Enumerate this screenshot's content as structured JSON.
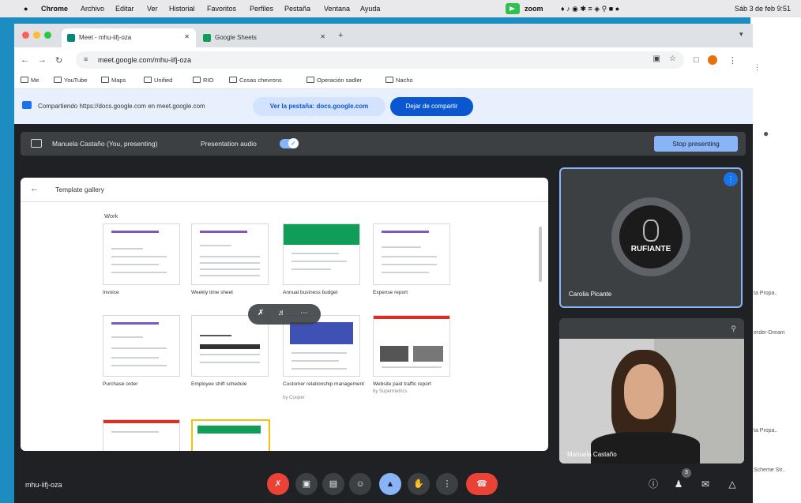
{
  "menubar": {
    "items": [
      "Chrome",
      "Archivo",
      "Editar",
      "Ver",
      "Historial",
      "Favoritos",
      "Perfiles",
      "Pestaña",
      "Ventana",
      "Ayuda"
    ],
    "zoom_label": "zoom",
    "datetime": "Sáb 3 de feb 9:51"
  },
  "browser": {
    "tabs": [
      {
        "label": "Meet - mhu-iifj-oza"
      },
      {
        "label": "Google Sheets"
      }
    ],
    "url": "meet.google.com/mhu-iifj-oza",
    "bookmarks": [
      "Me",
      "YouTube",
      "Maps",
      "Unified",
      "RIO",
      "Cosas chevrons",
      "Operación sadler",
      "Nacho"
    ]
  },
  "sharebar": {
    "text": "Compartiendo https://docs.google.com en meet.google.com",
    "view_tab": "Ver la pestaña: docs.google.com",
    "stop_share": "Dejar de compartir"
  },
  "presenting": {
    "name": "Manuela Castaño (You, presenting)",
    "audio_label": "Presentation audio",
    "stop_button": "Stop presenting"
  },
  "screen": {
    "title": "Template gallery",
    "section": "Work",
    "templates": [
      {
        "label": "Invoice",
        "sub": ""
      },
      {
        "label": "Weekly time sheet",
        "sub": ""
      },
      {
        "label": "Annual business budget",
        "sub": ""
      },
      {
        "label": "Expense report",
        "sub": ""
      },
      {
        "label": "Purchase order",
        "sub": ""
      },
      {
        "label": "Employee shift schedule",
        "sub": ""
      },
      {
        "label": "Customer relationship management",
        "sub": "by Cooper"
      },
      {
        "label": "Website paid traffic report",
        "sub": "by Supermetrics"
      }
    ]
  },
  "participants": {
    "tile1_name": "Carolia Picante",
    "tile1_logo": "RUFIANTE",
    "tile2_name": "Manuela Castaño"
  },
  "meeting_code": "mhu-iifj-oza",
  "participant_count": "3",
  "bg_window": [
    "ta Propa..",
    "erder-Dream",
    "ta Propa..",
    "Scheme Str.."
  ],
  "colors": {
    "end_call": "#ea4335",
    "present_active": "#8ab4f8",
    "accent": "#1a73e8"
  }
}
